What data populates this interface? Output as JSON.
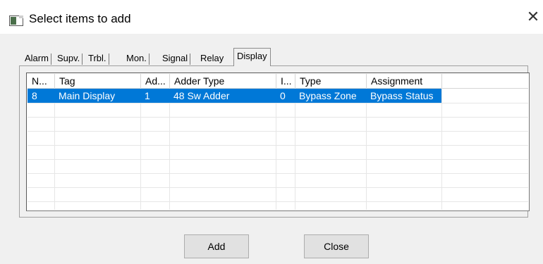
{
  "window": {
    "title": "Select items to add",
    "close_glyph": "✕"
  },
  "tabs": [
    {
      "label": "Alarm",
      "active": false
    },
    {
      "label": "Supv.",
      "active": false
    },
    {
      "label": "Trbl.",
      "active": false
    },
    {
      "label": "Mon.",
      "active": false
    },
    {
      "label": "Signal",
      "active": false
    },
    {
      "label": "Relay",
      "active": false
    },
    {
      "label": "Display",
      "active": true
    }
  ],
  "table": {
    "columns": [
      "N...",
      "Tag",
      "Ad...",
      "Adder Type",
      "I...",
      "Type",
      "Assignment",
      ""
    ],
    "rows": [
      {
        "selected": true,
        "cells": [
          "8",
          "Main Display",
          "1",
          "48 Sw Adder",
          "0",
          "Bypass Zone",
          "Bypass Status",
          ""
        ]
      }
    ]
  },
  "buttons": {
    "add": "Add",
    "close": "Close"
  },
  "colors": {
    "selection": "#0078d7",
    "background": "#f0f0f0"
  }
}
